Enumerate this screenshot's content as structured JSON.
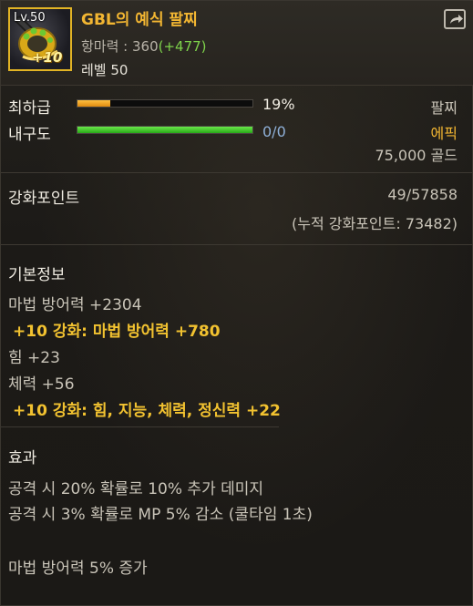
{
  "item": {
    "level_badge": "Lv.50",
    "name": "GBL의 예식 팔찌",
    "attack_label": "항마력 : 360",
    "attack_bonus": "(+477)",
    "required_level": "레벨 50",
    "icon": "bracelet-icon",
    "reinforce_badge": "+10",
    "share_icon": "share-icon"
  },
  "stats": {
    "grade_label": "최하급",
    "grade_percent_text": "19%",
    "grade_fill": 0.19,
    "durability_label": "내구도",
    "durability_text": "0/0",
    "durability_fill": 1.0,
    "item_type": "팔찌",
    "rarity": "에픽",
    "price": "75,000 골드"
  },
  "reinforce_points": {
    "label": "강화포인트",
    "value": "49/57858",
    "cumulative": "(누적 강화포인트: 73482)"
  },
  "basic_info": {
    "title": "기본정보",
    "lines": [
      {
        "text": "마법 방어력 +2304",
        "bonus": false
      },
      {
        "text": "+10 강화: 마법 방어력 +780",
        "bonus": true
      },
      {
        "text": "힘 +23",
        "bonus": false
      },
      {
        "text": "체력 +56",
        "bonus": false
      },
      {
        "text": "+10 강화: 힘, 지능, 체력, 정신력 +22",
        "bonus": true
      }
    ]
  },
  "effects": {
    "title": "효과",
    "lines": [
      "공격 시 20% 확률로 10% 추가 데미지",
      "공격 시 3% 확률로 MP 5% 감소 (쿨타임 1초)",
      "마법 방어력 5% 증가"
    ]
  },
  "colors": {
    "item_name": "#f2b632",
    "attack_bonus": "#7ed34b",
    "grade_bar": "#f0a020",
    "durability_bar": "#3ec52a",
    "rarity": "#f2b632",
    "bonus_text": "#f2c230"
  }
}
